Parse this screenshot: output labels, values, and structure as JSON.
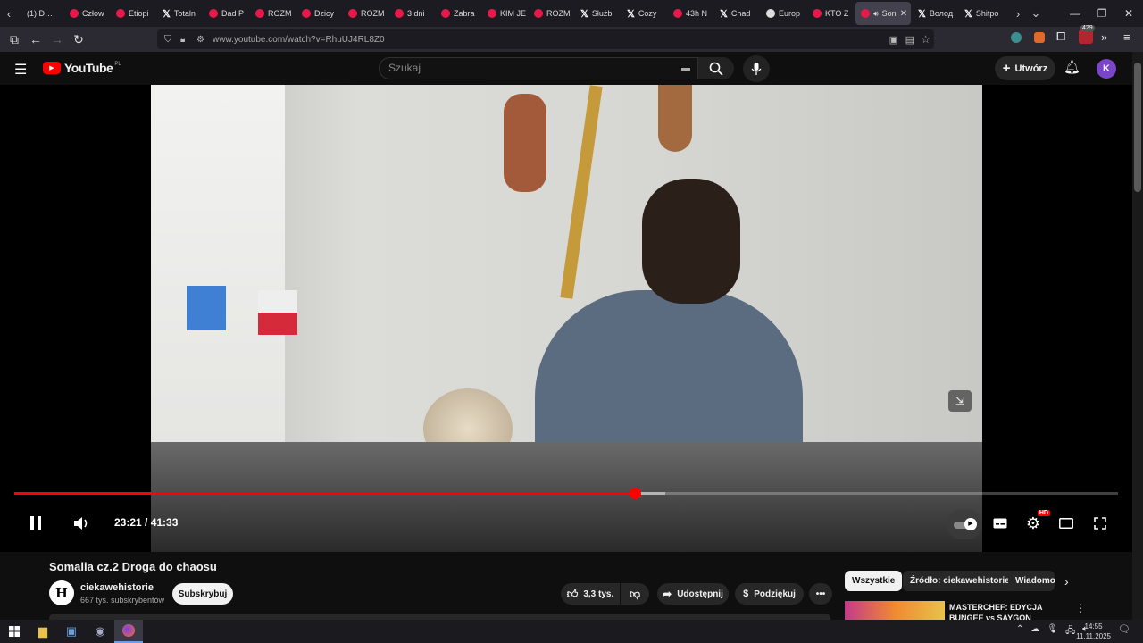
{
  "browser": {
    "tabs": [
      {
        "label": "(1) D…",
        "icon": "dl-icon"
      },
      {
        "label": "Człow",
        "icon": "youtube-icon"
      },
      {
        "label": "Etiopi",
        "icon": "youtube-icon"
      },
      {
        "label": "Totaln",
        "icon": "x-icon"
      },
      {
        "label": "Dad P",
        "icon": "youtube-icon"
      },
      {
        "label": "ROZM",
        "icon": "youtube-icon"
      },
      {
        "label": "Dzicy",
        "icon": "youtube-icon"
      },
      {
        "label": "ROZM",
        "icon": "youtube-icon"
      },
      {
        "label": "3 dni",
        "icon": "youtube-icon"
      },
      {
        "label": "Zabra",
        "icon": "youtube-icon"
      },
      {
        "label": "KIM JE",
        "icon": "youtube-icon"
      },
      {
        "label": "ROZM",
        "icon": "youtube-icon"
      },
      {
        "label": "Służb",
        "icon": "x-icon"
      },
      {
        "label": "Cozy",
        "icon": "x-icon"
      },
      {
        "label": "43h N",
        "icon": "youtube-icon"
      },
      {
        "label": "Chad",
        "icon": "x-icon"
      },
      {
        "label": "Europ",
        "icon": "globe-icon"
      },
      {
        "label": "KTO Z",
        "icon": "youtube-icon"
      },
      {
        "label": "Son",
        "icon": "youtube-icon",
        "active": true
      },
      {
        "label": "Волод",
        "icon": "x-icon"
      },
      {
        "label": "Shitpo",
        "icon": "x-icon"
      }
    ],
    "url": "www.youtube.com/watch?v=RhuUJ4RL8Z0",
    "extension_badge": "429"
  },
  "youtube": {
    "logo_text": "YouTube",
    "logo_region": "PL",
    "search_placeholder": "Szukaj",
    "create_label": "Utwórz",
    "avatar_letter": "K"
  },
  "player": {
    "current_time": "23:21",
    "duration": "41:33",
    "time_display": "23:21 / 41:33",
    "progress_fraction": 0.562,
    "buffered_fraction": 0.59,
    "quality_badge": "HD"
  },
  "video": {
    "title": "Somalia cz.2 Droga do chaosu",
    "channel_logo_letter": "H",
    "channel_name": "ciekawehistorie",
    "subscribers": "667 tys. subskrybentów",
    "subscribe_label": "Subskrybuj",
    "likes": "3,3 tys.",
    "share_label": "Udostępnij",
    "thanks_label": "Podziękuj"
  },
  "sidebar": {
    "chips": [
      "Wszystkie",
      "Źródło: ciekawehistorie",
      "Wiadomo"
    ],
    "recommendation_title": "MASTERCHEF: EDYCJA BUNGEE vs SAYGON"
  },
  "taskbar": {
    "time": "14:55",
    "date": "11.11.2025"
  }
}
